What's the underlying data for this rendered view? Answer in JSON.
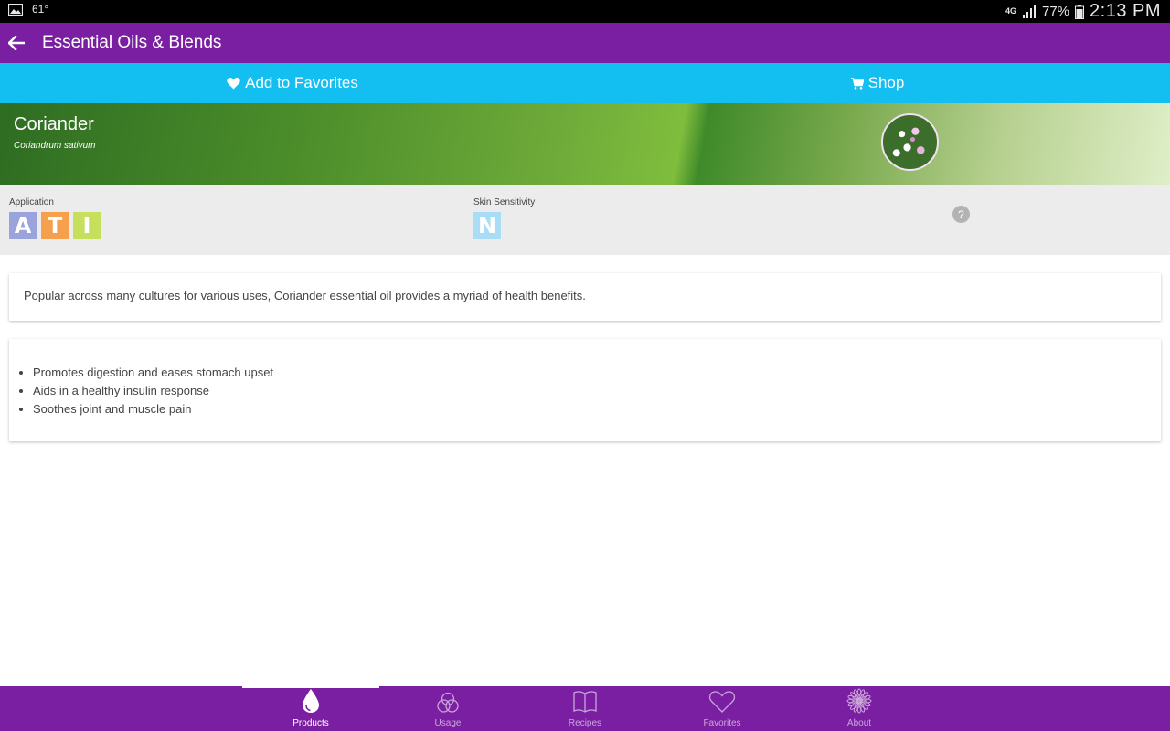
{
  "status_bar": {
    "temperature": "61°",
    "network": "4G",
    "battery": "77%",
    "time": "2:13 PM"
  },
  "app_bar": {
    "title": "Essential Oils & Blends"
  },
  "actions": {
    "favorites_label": "Add to Favorites",
    "shop_label": "Shop"
  },
  "product": {
    "name": "Coriander",
    "latin_name": "Coriandrum sativum"
  },
  "info": {
    "application_label": "Application",
    "application_badges": [
      {
        "letter": "A",
        "color": "#9aa3dc"
      },
      {
        "letter": "T",
        "color": "#f6a04d"
      },
      {
        "letter": "I",
        "color": "#c6df5c"
      }
    ],
    "sensitivity_label": "Skin Sensitivity",
    "sensitivity_badges": [
      {
        "letter": "N",
        "color": "#a9dcf7"
      }
    ],
    "help_symbol": "?"
  },
  "description": "Popular across many cultures for various uses, Coriander essential oil provides a myriad of health benefits.",
  "benefits": [
    "Promotes digestion and eases stomach upset",
    "Aids in a healthy insulin response",
    "Soothes joint and muscle pain"
  ],
  "bottom_nav": {
    "items": [
      {
        "label": "Products",
        "icon": "drop-icon",
        "active": true
      },
      {
        "label": "Usage",
        "icon": "circles-icon",
        "active": false
      },
      {
        "label": "Recipes",
        "icon": "book-icon",
        "active": false
      },
      {
        "label": "Favorites",
        "icon": "heart-icon",
        "active": false
      },
      {
        "label": "About",
        "icon": "flower-icon",
        "active": false
      }
    ]
  },
  "colors": {
    "primary": "#7b1fa2",
    "accent": "#12bff0"
  }
}
